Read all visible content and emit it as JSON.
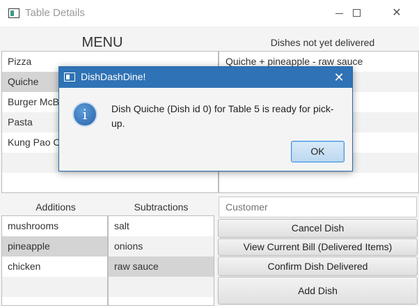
{
  "window": {
    "title": "Table Details",
    "minimize_icon": "minimize-icon",
    "maximize_icon": "maximize-icon",
    "close_glyph": "✕"
  },
  "menu": {
    "heading": "MENU",
    "items": [
      {
        "label": "Pizza"
      },
      {
        "label": "Quiche"
      },
      {
        "label": "Burger McB"
      },
      {
        "label": "Pasta"
      },
      {
        "label": "Kung Pao C"
      }
    ],
    "selected_index": 1
  },
  "undelivered": {
    "heading": "Dishes not yet delivered",
    "items": [
      {
        "label": "Quiche + pineapple - raw sauce"
      }
    ]
  },
  "additions": {
    "heading": "Additions",
    "items": [
      {
        "label": "mushrooms"
      },
      {
        "label": "pineapple"
      },
      {
        "label": "chicken"
      }
    ],
    "selected_index": 1
  },
  "subtractions": {
    "heading": "Subtractions",
    "items": [
      {
        "label": "salt"
      },
      {
        "label": "onions"
      },
      {
        "label": "raw sauce"
      }
    ],
    "selected_index": 2
  },
  "customer": {
    "placeholder": "Customer"
  },
  "actions": {
    "cancel": "Cancel Dish",
    "view_bill": "View Current Bill (Delivered Items)",
    "confirm": "Confirm Dish Delivered",
    "add": "Add Dish"
  },
  "dialog": {
    "title": "DishDashDine!",
    "close_glyph": "✕",
    "icon_glyph": "i",
    "message": "Dish Quiche (Dish id 0) for Table 5 is ready for pick-up.",
    "ok": "OK"
  }
}
